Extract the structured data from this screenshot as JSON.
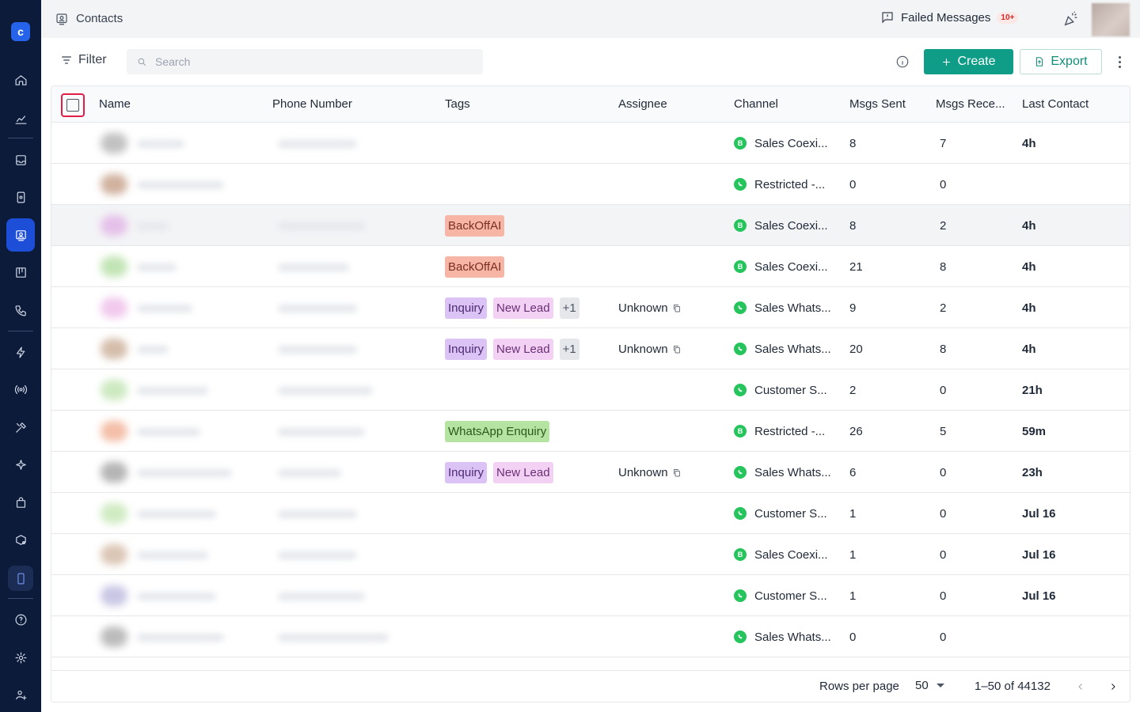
{
  "header": {
    "title": "Contacts",
    "failed_messages_label": "Failed Messages",
    "failed_messages_badge": "10+"
  },
  "toolbar": {
    "filter_label": "Filter",
    "search_placeholder": "Search",
    "create_label": "Create",
    "export_label": "Export"
  },
  "table": {
    "columns": {
      "name": "Name",
      "phone": "Phone Number",
      "tags": "Tags",
      "assignee": "Assignee",
      "channel": "Channel",
      "msgs_sent": "Msgs Sent",
      "msgs_received": "Msgs Rece...",
      "last_contact": "Last Contact"
    },
    "rows": [
      {
        "tags": [],
        "assignee": "",
        "channel": "Sales Coexi...",
        "channel_type": "business",
        "sent": "8",
        "received": "7",
        "last": "4h"
      },
      {
        "tags": [],
        "assignee": "",
        "channel": "Restricted -...",
        "channel_type": "whatsapp",
        "sent": "0",
        "received": "0",
        "last": ""
      },
      {
        "tags": [
          {
            "label": "BackOffAI",
            "kind": "backoff"
          }
        ],
        "assignee": "",
        "channel": "Sales Coexi...",
        "channel_type": "business",
        "sent": "8",
        "received": "2",
        "last": "4h"
      },
      {
        "tags": [
          {
            "label": "BackOffAI",
            "kind": "backoff"
          }
        ],
        "assignee": "",
        "channel": "Sales Coexi...",
        "channel_type": "business",
        "sent": "21",
        "received": "8",
        "last": "4h"
      },
      {
        "tags": [
          {
            "label": "Inquiry",
            "kind": "inquiry"
          },
          {
            "label": "New Lead",
            "kind": "newlead"
          },
          {
            "label": "+1",
            "kind": "more"
          }
        ],
        "assignee": "Unknown",
        "channel": "Sales Whats...",
        "channel_type": "whatsapp",
        "sent": "9",
        "received": "2",
        "last": "4h"
      },
      {
        "tags": [
          {
            "label": "Inquiry",
            "kind": "inquiry"
          },
          {
            "label": "New Lead",
            "kind": "newlead"
          },
          {
            "label": "+1",
            "kind": "more"
          }
        ],
        "assignee": "Unknown",
        "channel": "Sales Whats...",
        "channel_type": "whatsapp",
        "sent": "20",
        "received": "8",
        "last": "4h"
      },
      {
        "tags": [],
        "assignee": "",
        "channel": "Customer S...",
        "channel_type": "whatsapp",
        "sent": "2",
        "received": "0",
        "last": "21h"
      },
      {
        "tags": [
          {
            "label": "WhatsApp Enquiry",
            "kind": "wa"
          }
        ],
        "assignee": "",
        "channel": "Restricted -...",
        "channel_type": "business",
        "sent": "26",
        "received": "5",
        "last": "59m"
      },
      {
        "tags": [
          {
            "label": "Inquiry",
            "kind": "inquiry"
          },
          {
            "label": "New Lead",
            "kind": "newlead"
          }
        ],
        "assignee": "Unknown",
        "channel": "Sales Whats...",
        "channel_type": "whatsapp",
        "sent": "6",
        "received": "0",
        "last": "23h"
      },
      {
        "tags": [],
        "assignee": "",
        "channel": "Customer S...",
        "channel_type": "whatsapp",
        "sent": "1",
        "received": "0",
        "last": "Jul 16"
      },
      {
        "tags": [],
        "assignee": "",
        "channel": "Sales Coexi...",
        "channel_type": "business",
        "sent": "1",
        "received": "0",
        "last": "Jul 16"
      },
      {
        "tags": [],
        "assignee": "",
        "channel": "Customer S...",
        "channel_type": "whatsapp",
        "sent": "1",
        "received": "0",
        "last": "Jul 16"
      },
      {
        "tags": [],
        "assignee": "",
        "channel": "Sales Whats...",
        "channel_type": "whatsapp",
        "sent": "0",
        "received": "0",
        "last": ""
      }
    ]
  },
  "footer": {
    "rows_per_page_label": "Rows per page",
    "rows_per_page_value": "50",
    "range_text": "1–50 of 44132"
  },
  "colors": {
    "sidebar_bg": "#0d1b3a",
    "primary": "#0f9d87",
    "whatsapp": "#25c45c",
    "active_nav": "#1d4ed8"
  }
}
